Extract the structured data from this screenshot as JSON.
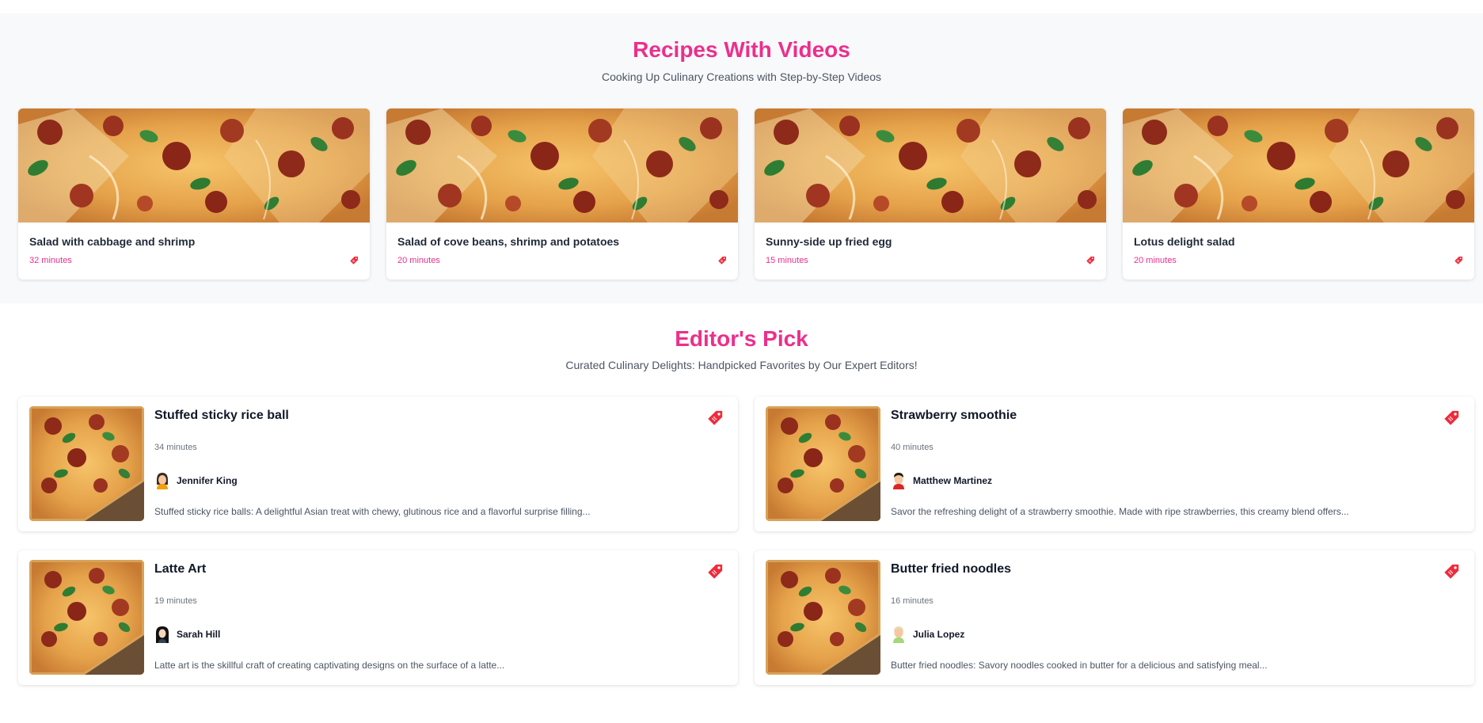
{
  "colors": {
    "accent": "#ec2f8c",
    "tag": "#ef2b3c",
    "section_bg": "#f8f9fb"
  },
  "videos": {
    "title": "Recipes With Videos",
    "subtitle": "Cooking Up Culinary Creations with Step-by-Step Videos",
    "items": [
      {
        "title": "Salad with cabbage and shrimp",
        "time": "32 minutes",
        "icon": "tag-icon"
      },
      {
        "title": "Salad of cove beans, shrimp and potatoes",
        "time": "20 minutes",
        "icon": "tag-icon"
      },
      {
        "title": "Sunny-side up fried egg",
        "time": "15 minutes",
        "icon": "tag-icon"
      },
      {
        "title": "Lotus delight salad",
        "time": "20 minutes",
        "icon": "tag-icon"
      }
    ]
  },
  "editors": {
    "title": "Editor's Pick",
    "subtitle": "Curated Culinary Delights: Handpicked Favorites by Our Expert Editors!",
    "items": [
      {
        "title": "Stuffed sticky rice ball",
        "time": "34 minutes",
        "author": "Jennifer King",
        "avatar": "woman-avatar-icon",
        "description": "Stuffed sticky rice balls: A delightful Asian treat with chewy, glutinous rice and a flavorful surprise filling..."
      },
      {
        "title": "Strawberry smoothie",
        "time": "40 minutes",
        "author": "Matthew Martinez",
        "avatar": "man-avatar-icon",
        "description": "Savor the refreshing delight of a strawberry smoothie. Made with ripe strawberries, this creamy blend offers..."
      },
      {
        "title": "Latte Art",
        "time": "19 minutes",
        "author": "Sarah Hill",
        "avatar": "hijab-avatar-icon",
        "description": "Latte art is the skillful craft of creating captivating designs on the surface of a latte..."
      },
      {
        "title": "Butter fried noodles",
        "time": "16 minutes",
        "author": "Julia Lopez",
        "avatar": "girl-avatar-icon",
        "description": "Butter fried noodles: Savory noodles cooked in butter for a delicious and satisfying meal..."
      }
    ]
  }
}
